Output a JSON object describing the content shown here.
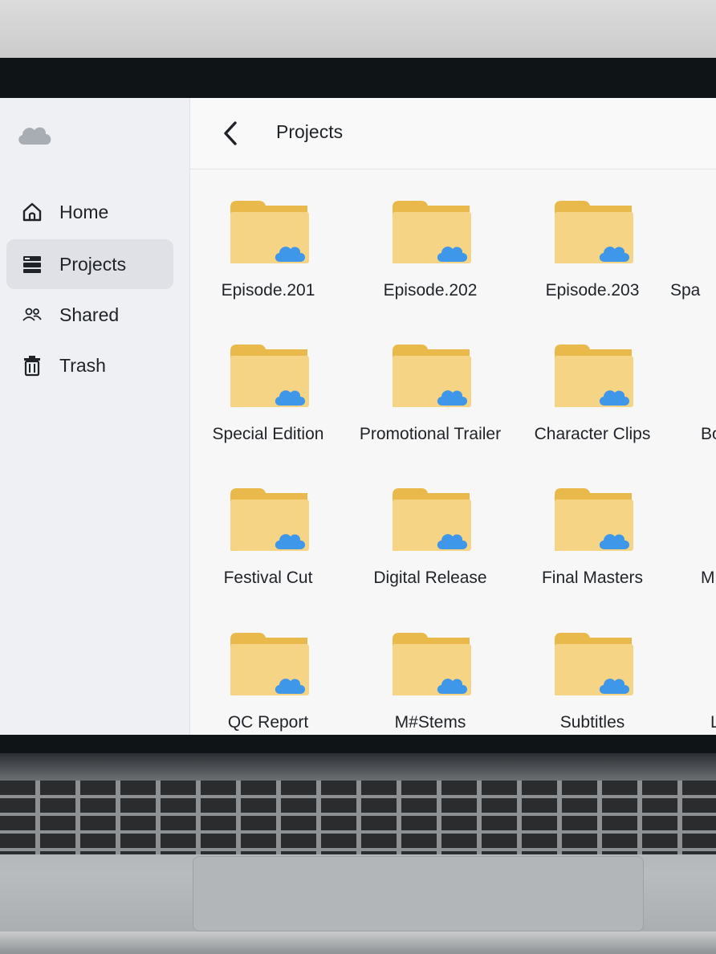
{
  "header": {
    "title": "Projects"
  },
  "sidebar": {
    "items": [
      {
        "label": "Home",
        "icon": "home-icon",
        "active": false
      },
      {
        "label": "Projects",
        "icon": "projects-icon",
        "active": true
      },
      {
        "label": "Shared",
        "icon": "shared-icon",
        "active": false
      },
      {
        "label": "Trash",
        "icon": "trash-icon",
        "active": false
      }
    ]
  },
  "folders": [
    {
      "label": "Episode.201"
    },
    {
      "label": "Episode.202"
    },
    {
      "label": "Episode.203"
    },
    {
      "label": "Spa"
    },
    {
      "label": "Special Edition"
    },
    {
      "label": "Promotional Trailer"
    },
    {
      "label": "Character Clips"
    },
    {
      "label": "Bo"
    },
    {
      "label": "Festival Cut"
    },
    {
      "label": "Digital Release"
    },
    {
      "label": "Final Masters"
    },
    {
      "label": "M"
    },
    {
      "label": "QC Report"
    },
    {
      "label": "M#Stems"
    },
    {
      "label": "Subtitles"
    },
    {
      "label": "L"
    }
  ],
  "colors": {
    "folder": "#f6d486",
    "folder_tab": "#eab94b",
    "cloud_badge": "#3e97e8",
    "sidebar_bg": "#eef0f3",
    "active_bg": "#dfe1e7"
  }
}
